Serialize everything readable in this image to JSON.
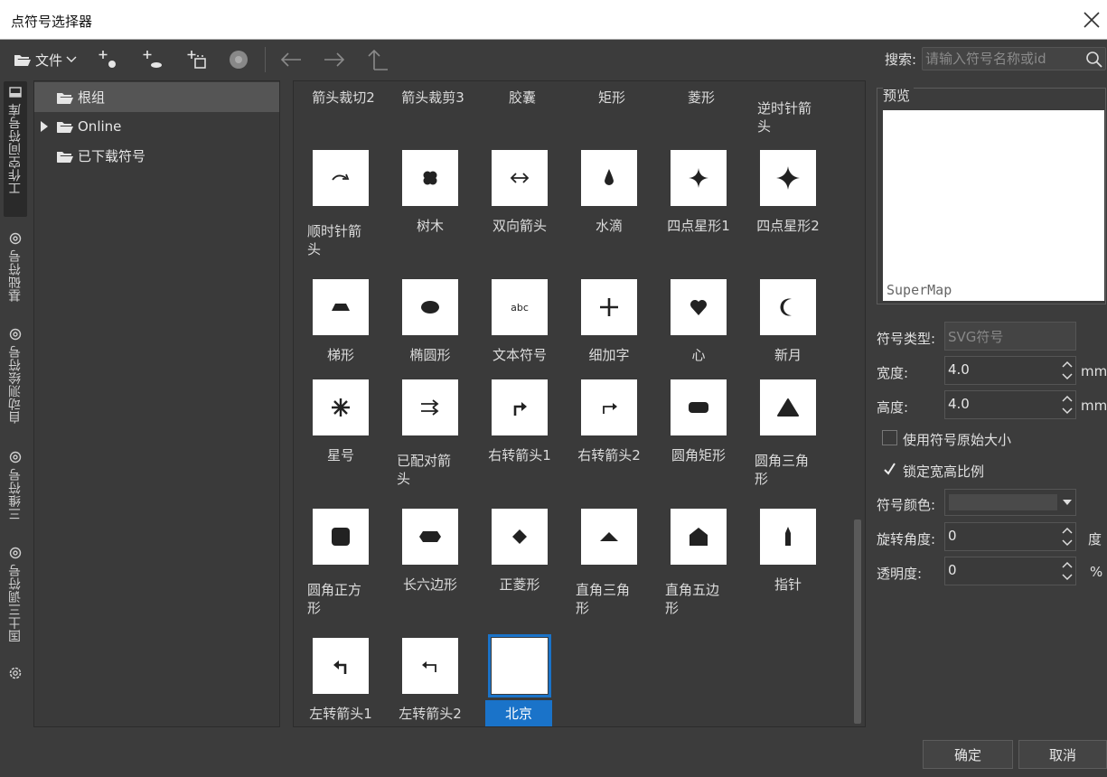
{
  "window": {
    "title": "点符号选择器"
  },
  "toolbar": {
    "file_label": "文件",
    "icons": [
      "add-point-icon",
      "add-ellipse-icon",
      "add-group-icon",
      "disc-icon",
      "back-icon",
      "forward-icon",
      "up-icon"
    ]
  },
  "search": {
    "label": "搜索:",
    "placeholder": "请输入符号名称或id"
  },
  "vertical_tabs": [
    {
      "label": "工作空间符号库",
      "active": true
    },
    {
      "label": "基础符号",
      "active": false
    },
    {
      "label": "自动测绘符号",
      "active": false
    },
    {
      "label": "三维符号",
      "active": false
    },
    {
      "label": "国土三调符号",
      "active": false
    }
  ],
  "tree": {
    "items": [
      {
        "label": "根组",
        "selected": true
      },
      {
        "label": "Online",
        "selected": false
      },
      {
        "label": "已下载符号",
        "selected": false
      }
    ]
  },
  "grid": {
    "top_row": [
      "箭头裁切2",
      "箭头裁剪3",
      "胶囊",
      "矩形",
      "菱形",
      "逆时针箭头"
    ],
    "rows": [
      [
        "顺时针箭头",
        "树木",
        "双向箭头",
        "水滴",
        "四点星形1",
        "四点星形2"
      ],
      [
        "梯形",
        "椭圆形",
        "文本符号",
        "细加字",
        "心",
        "新月"
      ],
      [
        "星号",
        "已配对箭头",
        "右转箭头1",
        "右转箭头2",
        "圆角矩形",
        "圆角三角形"
      ],
      [
        "圆角正方形",
        "长六边形",
        "正菱形",
        "直角三角形",
        "直角五边形",
        "指针"
      ],
      [
        "左转箭头1",
        "左转箭头2",
        "北京"
      ]
    ],
    "selected": "北京",
    "text_symbol_sample": "abc"
  },
  "preview": {
    "title": "预览",
    "watermark": "SuperMap"
  },
  "properties": {
    "type_label": "符号类型:",
    "type_value": "SVG符号",
    "width_label": "宽度:",
    "width_value": "4.0",
    "width_unit": "mm",
    "height_label": "高度:",
    "height_value": "4.0",
    "height_unit": "mm",
    "original_size_label": "使用符号原始大小",
    "original_size_checked": false,
    "lock_ratio_label": "锁定宽高比例",
    "lock_ratio_checked": true,
    "color_label": "符号颜色:",
    "rotation_label": "旋转角度:",
    "rotation_value": "0",
    "rotation_unit": "度",
    "opacity_label": "透明度:",
    "opacity_value": "0",
    "opacity_unit": "%"
  },
  "buttons": {
    "ok": "确定",
    "cancel": "取消"
  },
  "colors": {
    "accent": "#1a73c9",
    "background": "#3c3c3c",
    "panel": "#3a3a3a"
  }
}
